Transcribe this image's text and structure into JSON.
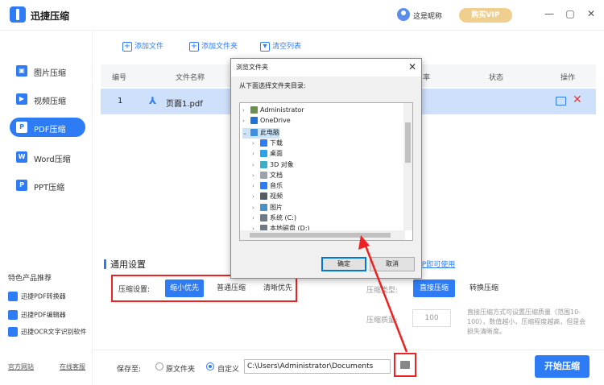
{
  "app": {
    "title": "迅捷压缩",
    "user_name": "这是昵称",
    "vip_button": "购买VIP"
  },
  "window_controls": [
    "—",
    "▢",
    "✕"
  ],
  "sidebar": {
    "items": [
      {
        "label": "图片压缩",
        "icon": "image-icon",
        "active": false
      },
      {
        "label": "视频压缩",
        "icon": "video-icon",
        "active": false
      },
      {
        "label": "PDF压缩",
        "icon": "pdf-icon",
        "active": true
      },
      {
        "label": "Word压缩",
        "icon": "word-icon",
        "active": false
      },
      {
        "label": "PPT压缩",
        "icon": "ppt-icon",
        "active": false
      }
    ],
    "recommend_title": "特色产品推荐",
    "recommend": [
      "迅捷PDF转换器",
      "迅捷PDF编辑器",
      "迅捷OCR文字识别软件"
    ],
    "links": {
      "official": "官方网站",
      "service": "在线客服"
    }
  },
  "toolbar": {
    "add_file": "添加文件",
    "add_folder": "添加文件夹",
    "clear_list": "清空列表"
  },
  "table": {
    "headers": {
      "index": "编号",
      "name": "文件名称",
      "ratio": "率",
      "status": "状态",
      "action": "操作"
    },
    "rows": [
      {
        "index": "1",
        "name": "页面1.pdf"
      }
    ]
  },
  "settings": {
    "title": "通用设置",
    "level_label": "压缩设置:",
    "levels": [
      "缩小优先",
      "普通压缩",
      "清晰优先"
    ],
    "vip_link": "VIP即可使用",
    "type_label": "压缩类型:",
    "types": [
      "直接压缩",
      "转换压缩"
    ],
    "quality_label": "压缩质量:",
    "quality_value": "100",
    "quality_tip": "直接压缩方式可设置压缩质量（范围10-100），数值越小，压缩程度越高，但是会损失清晰度。"
  },
  "bottom": {
    "save_label": "保存至:",
    "options": [
      "原文件夹",
      "自定义"
    ],
    "path": "C:\\Users\\Administrator\\Documents",
    "start_button": "开始压缩"
  },
  "dialog": {
    "title": "浏览文件夹",
    "prompt": "从下面选择文件夹目录:",
    "tree": [
      {
        "label": "Administrator",
        "icon": "user-folder-icon",
        "indent": 0,
        "expand": "›",
        "color": "#6b8e4e"
      },
      {
        "label": "OneDrive",
        "icon": "cloud-icon",
        "indent": 0,
        "expand": "›",
        "color": "#1e73d6"
      },
      {
        "label": "此电脑",
        "icon": "computer-icon",
        "indent": 0,
        "expand": "⌄",
        "color": "#3c8fe0",
        "selected": true
      },
      {
        "label": "下载",
        "icon": "download-icon",
        "indent": 1,
        "expand": "›",
        "color": "#2d7cf6"
      },
      {
        "label": "桌面",
        "icon": "desktop-icon",
        "indent": 1,
        "expand": "›",
        "color": "#2aa3e8"
      },
      {
        "label": "3D 对象",
        "icon": "cube-icon",
        "indent": 1,
        "expand": "›",
        "color": "#3ab0c8"
      },
      {
        "label": "文档",
        "icon": "document-icon",
        "indent": 1,
        "expand": "›",
        "color": "#9aa3ad"
      },
      {
        "label": "音乐",
        "icon": "music-icon",
        "indent": 1,
        "expand": "›",
        "color": "#2d7cf6"
      },
      {
        "label": "视频",
        "icon": "video-folder-icon",
        "indent": 1,
        "expand": "›",
        "color": "#555c66"
      },
      {
        "label": "图片",
        "icon": "pictures-icon",
        "indent": 1,
        "expand": "›",
        "color": "#4a90c8"
      },
      {
        "label": "系统 (C:)",
        "icon": "drive-icon",
        "indent": 1,
        "expand": "›",
        "color": "#6d7a88"
      },
      {
        "label": "本地磁盘 (D:)",
        "icon": "drive-icon",
        "indent": 1,
        "expand": "›",
        "color": "#6d7a88"
      }
    ],
    "ok": "确定",
    "cancel": "取消"
  },
  "colors": {
    "accent": "#2d7cf6",
    "highlight": "#e22222",
    "row_selected": "#cfe0fb",
    "vip": "#f0cf8e"
  }
}
